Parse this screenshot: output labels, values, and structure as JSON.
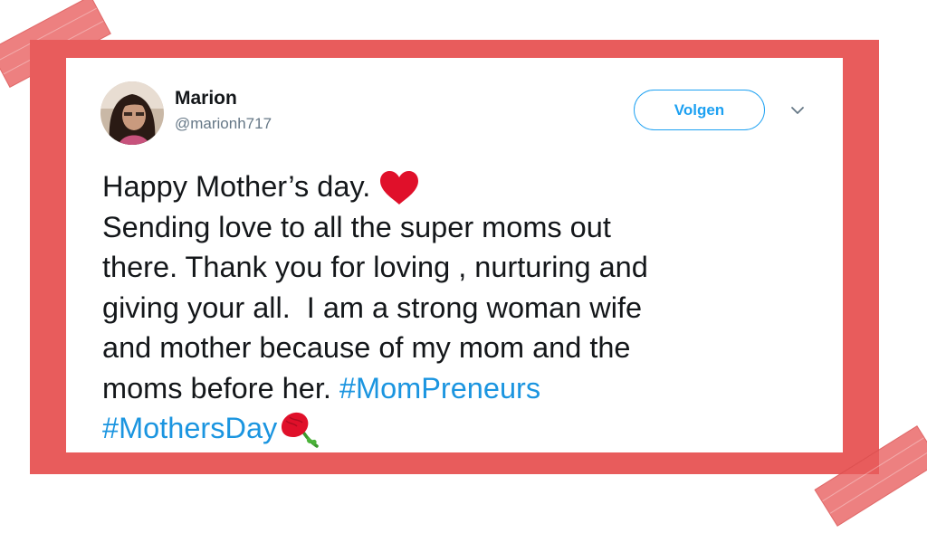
{
  "tweet": {
    "author_name": "Marion",
    "author_handle": "@marionh717",
    "follow_label": "Volgen",
    "lines": {
      "l1": "Happy Mother’s day. ",
      "l2": "Sending love to all the super moms out",
      "l3": "there. Thank you for loving , nurturing and",
      "l4": "giving your all.  I am a strong woman wife",
      "l5": "and mother because of my mom and the",
      "l6": "moms before her. "
    },
    "hashtags": {
      "mompreneurs": "#MomPreneurs",
      "mothersday": "#MothersDay"
    },
    "icons": {
      "heart": "red-heart-icon",
      "flower": "carnation-icon",
      "menu": "chevron-down-icon"
    }
  },
  "colors": {
    "frame": "#e85c5c",
    "link": "#1b95e0",
    "follow": "#1da1f2",
    "handle": "#657786",
    "text": "#14171a"
  }
}
